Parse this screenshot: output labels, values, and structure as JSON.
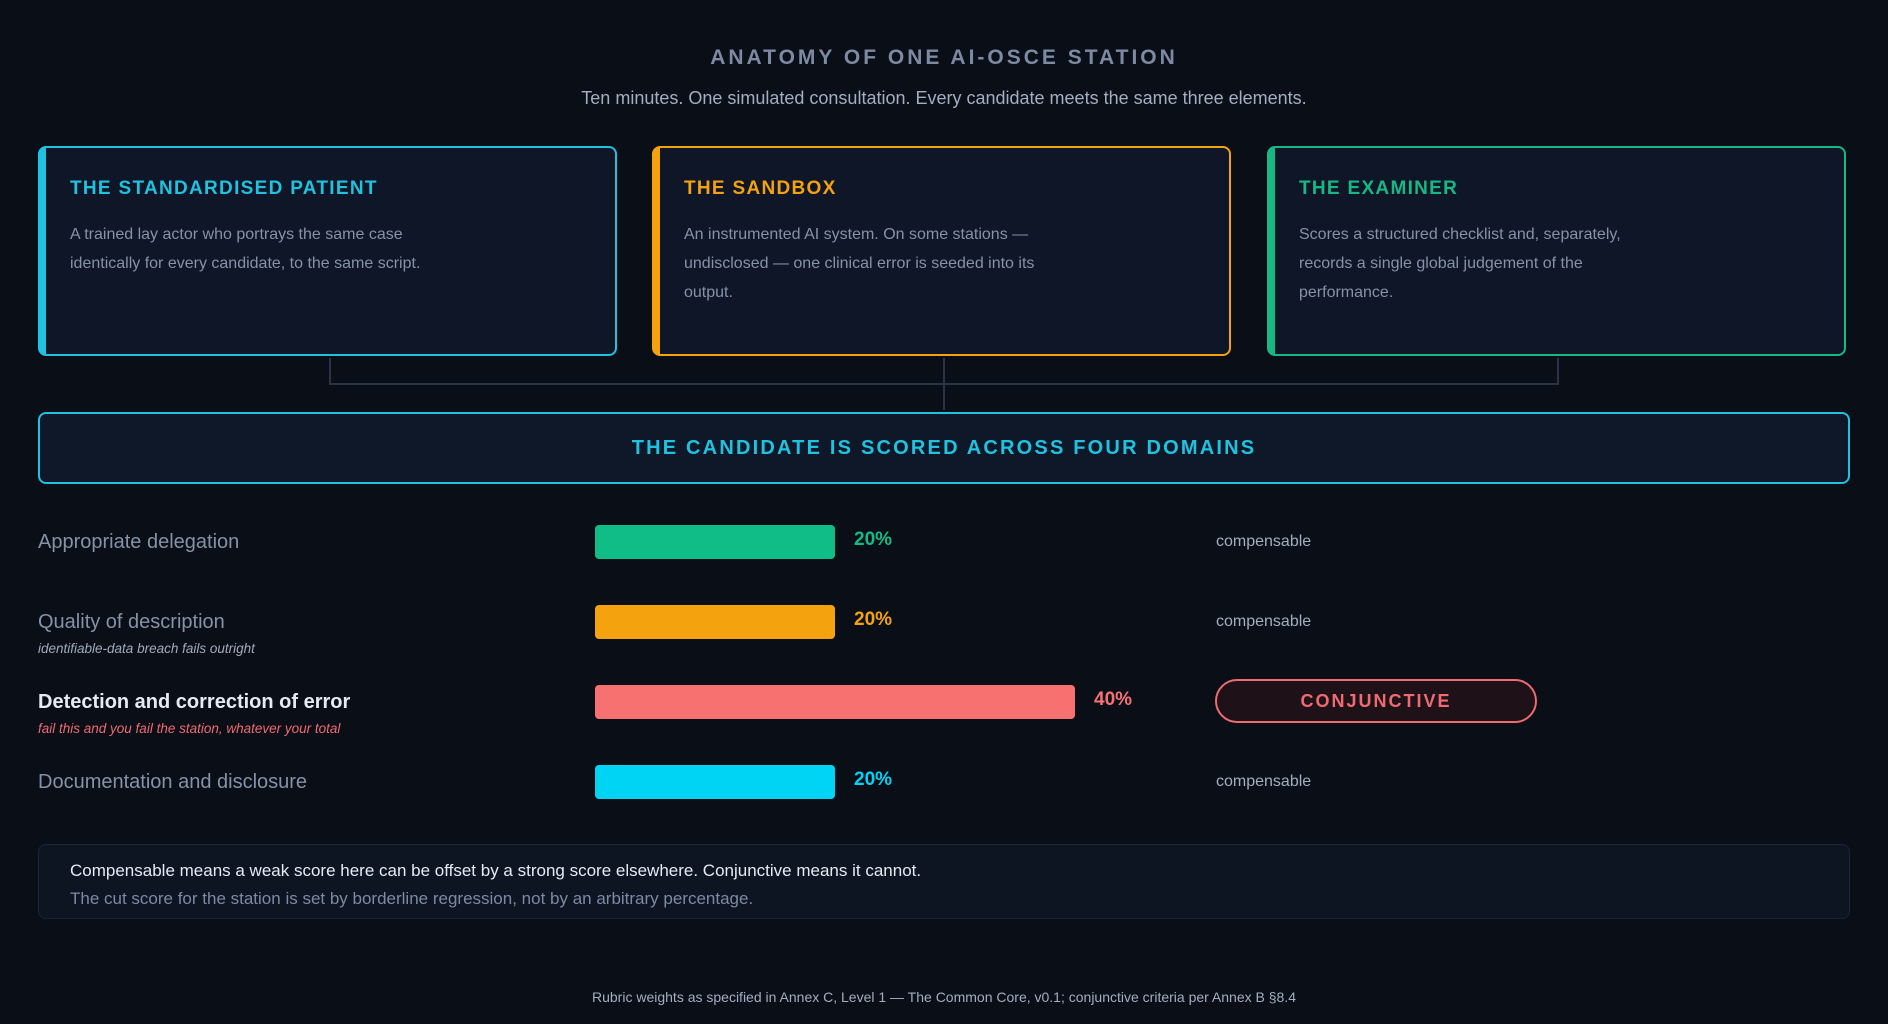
{
  "header": {
    "title": "ANATOMY OF ONE AI-OSCE STATION",
    "subtitle": "Ten minutes. One simulated consultation. Every candidate meets the same three elements."
  },
  "cards": [
    {
      "title": "THE STANDARDISED PATIENT",
      "body": "A trained lay actor who portrays the same case identically for every candidate, to the same script.",
      "color": "#1fc3e0"
    },
    {
      "title": "THE SANDBOX",
      "body": "An instrumented AI system. On some stations — undisclosed — one clinical error is seeded into its output.",
      "color": "#f5a20f"
    },
    {
      "title": "THE EXAMINER",
      "body": "Scores a structured checklist and, separately, records a single global judgement of the performance.",
      "color": "#16b984"
    }
  ],
  "banner": {
    "label": "THE CANDIDATE IS SCORED ACROSS FOUR DOMAINS"
  },
  "domains": [
    {
      "label": "Appropriate delegation",
      "note": "",
      "weight": 20,
      "weight_label": "20%",
      "color": "#10bd86",
      "criterion": "compensable"
    },
    {
      "label": "Quality of description",
      "note": "identifiable-data breach fails outright",
      "weight": 20,
      "weight_label": "20%",
      "color": "#f5a20f",
      "criterion": "compensable"
    },
    {
      "label": "Detection and correction of error",
      "note": "fail this and you fail the station, whatever your total",
      "weight": 40,
      "weight_label": "40%",
      "color": "#f87171",
      "criterion": "CONJUNCTIVE"
    },
    {
      "label": "Documentation and disclosure",
      "note": "",
      "weight": 20,
      "weight_label": "20%",
      "color": "#00d4f5",
      "criterion": "compensable"
    }
  ],
  "explanation": {
    "line1": "Compensable means a weak score here can be offset by a strong score elsewhere. Conjunctive means it cannot.",
    "line2": "The cut score for the station is set by borderline regression, not by an arbitrary percentage."
  },
  "footer": {
    "source": "Rubric weights as specified in Annex C, Level 1 — The Common Core, v0.1; conjunctive criteria per Annex B §8.4"
  }
}
